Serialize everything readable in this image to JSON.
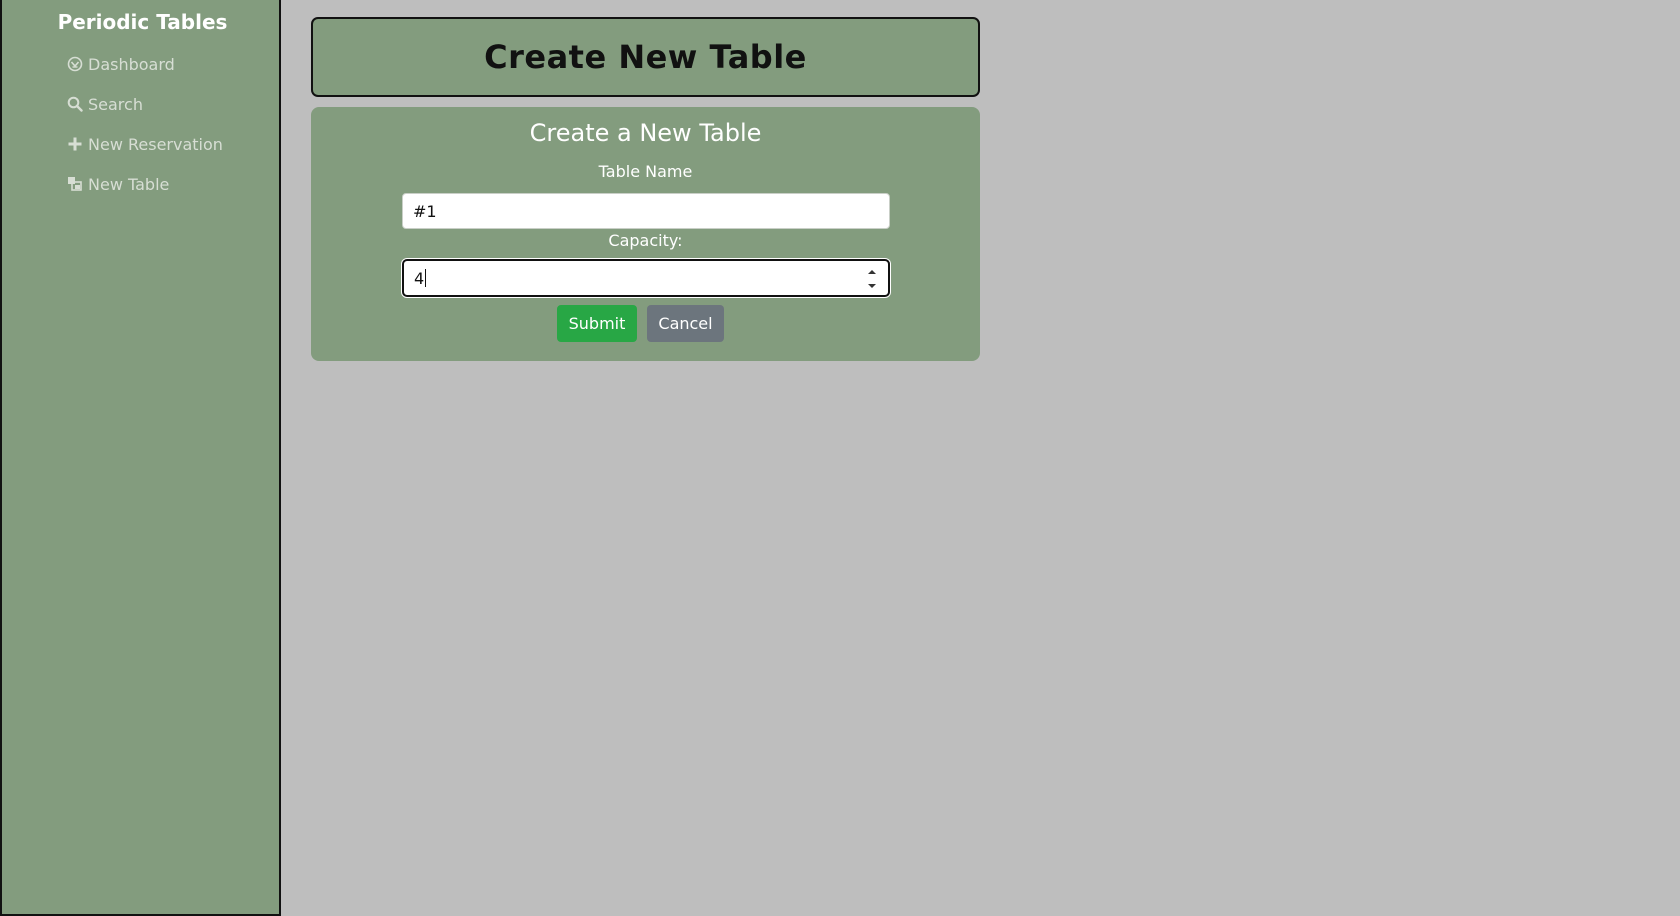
{
  "app": {
    "brand": "Periodic Tables"
  },
  "sidebar": {
    "items": [
      {
        "label": "Dashboard",
        "icon": "dashboard-icon"
      },
      {
        "label": "Search",
        "icon": "search-icon"
      },
      {
        "label": "New Reservation",
        "icon": "plus-icon"
      },
      {
        "label": "New Table",
        "icon": "table-icon"
      }
    ]
  },
  "page": {
    "title": "Create New Table"
  },
  "form": {
    "heading": "Create a New Table",
    "table_name_label": "Table Name",
    "table_name_value": "#1",
    "capacity_label": "Capacity:",
    "capacity_value": "4",
    "submit_label": "Submit",
    "cancel_label": "Cancel"
  },
  "colors": {
    "panel": "#839c7e",
    "background": "#bebebe",
    "submit": "#28a745",
    "cancel": "#6c757d"
  }
}
